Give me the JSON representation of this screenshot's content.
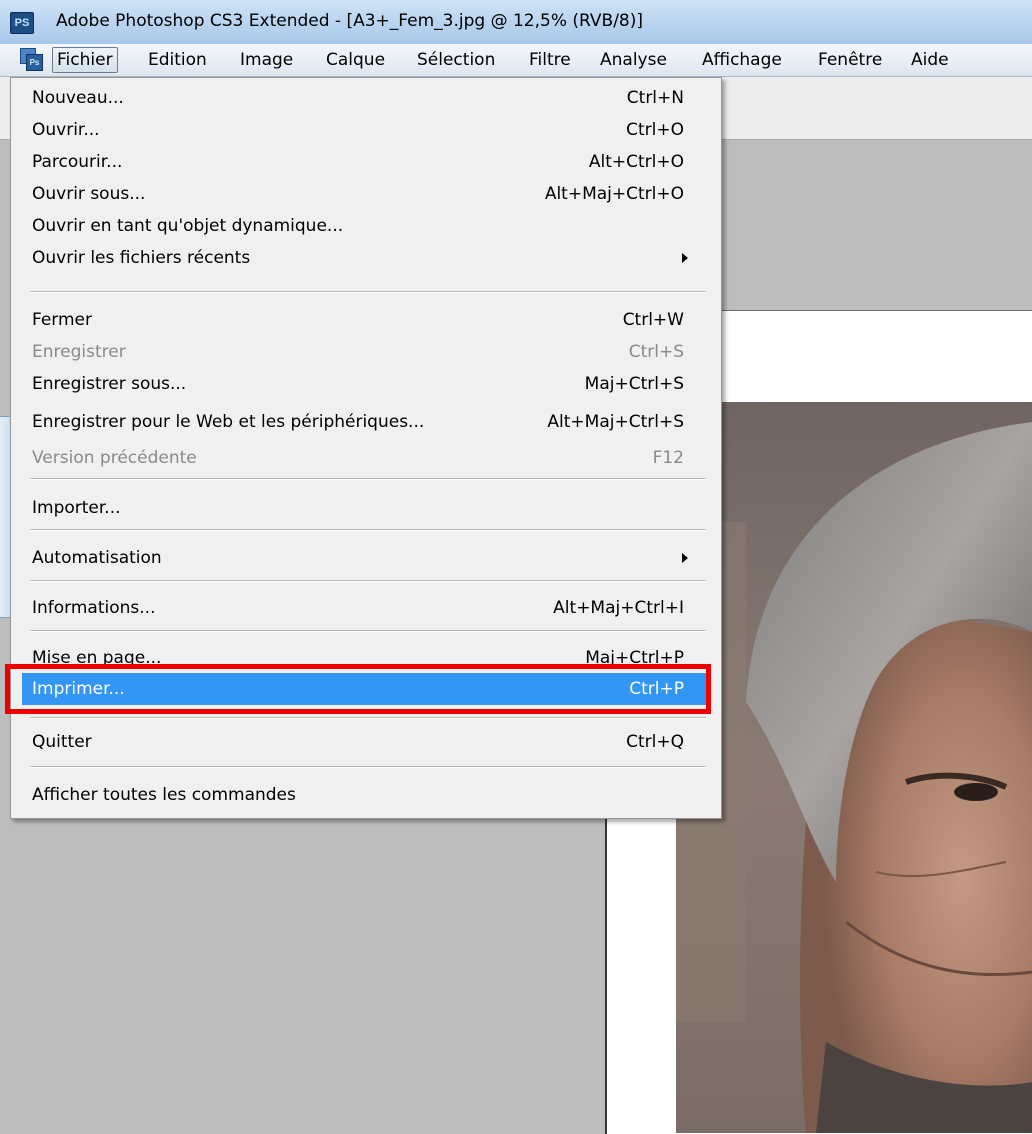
{
  "window": {
    "app_icon": "PS",
    "title": "Adobe Photoshop CS3 Extended - [A3+_Fem_3.jpg @ 12,5% (RVB/8)]"
  },
  "menubar": {
    "doc_icon": "Ps",
    "items": [
      {
        "label": "Fichier",
        "active": true
      },
      {
        "label": "Edition"
      },
      {
        "label": "Image"
      },
      {
        "label": "Calque"
      },
      {
        "label": "Sélection"
      },
      {
        "label": "Filtre"
      },
      {
        "label": "Analyse"
      },
      {
        "label": "Affichage"
      },
      {
        "label": "Fenêtre"
      },
      {
        "label": "Aide"
      }
    ]
  },
  "file_menu": {
    "items": [
      {
        "label": "Nouveau...",
        "shortcut": "Ctrl+N"
      },
      {
        "label": "Ouvrir...",
        "shortcut": "Ctrl+O"
      },
      {
        "label": "Parcourir...",
        "shortcut": "Alt+Ctrl+O"
      },
      {
        "label": "Ouvrir sous...",
        "shortcut": "Alt+Maj+Ctrl+O"
      },
      {
        "label": "Ouvrir en tant qu'objet dynamique...",
        "shortcut": ""
      },
      {
        "label": "Ouvrir les fichiers récents",
        "shortcut": "",
        "submenu": true
      },
      {
        "label": "Fermer",
        "shortcut": "Ctrl+W"
      },
      {
        "label": "Enregistrer",
        "shortcut": "Ctrl+S",
        "disabled": true
      },
      {
        "label": "Enregistrer sous...",
        "shortcut": "Maj+Ctrl+S"
      },
      {
        "label": "Enregistrer pour le Web et les périphériques...",
        "shortcut": "Alt+Maj+Ctrl+S"
      },
      {
        "label": "Version précédente",
        "shortcut": "F12",
        "disabled": true
      },
      {
        "label": "Importer...",
        "shortcut": ""
      },
      {
        "label": "Automatisation",
        "shortcut": "",
        "submenu": true
      },
      {
        "label": "Informations...",
        "shortcut": "Alt+Maj+Ctrl+I"
      },
      {
        "label": "Mise en page...",
        "shortcut": "Maj+Ctrl+P"
      },
      {
        "label": "Imprimer...",
        "shortcut": "Ctrl+P",
        "selected": true
      },
      {
        "label": "Quitter",
        "shortcut": "Ctrl+Q"
      },
      {
        "label": "Afficher toutes les commandes",
        "shortcut": ""
      }
    ]
  },
  "colors": {
    "highlight": "#3396f4",
    "annotation": "#ee0000"
  }
}
